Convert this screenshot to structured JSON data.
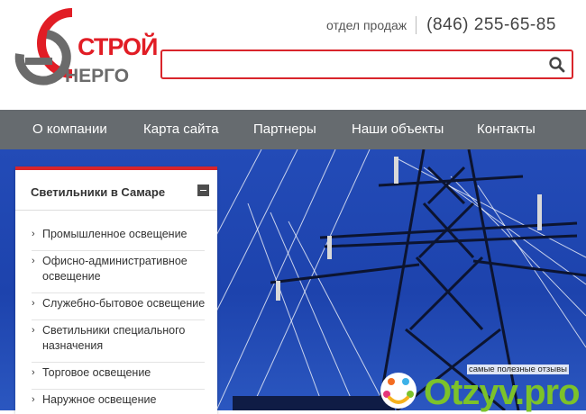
{
  "logo": {
    "line1": "СТРОЙ",
    "line2": "НЕРГО",
    "letter": "Э"
  },
  "header": {
    "department": "отдел продаж",
    "phone": "(846) 255-65-85"
  },
  "search": {
    "value": "",
    "placeholder": ""
  },
  "nav": {
    "items": [
      {
        "label": "О компании"
      },
      {
        "label": "Карта сайта"
      },
      {
        "label": "Партнеры"
      },
      {
        "label": "Наши объекты"
      },
      {
        "label": "Контакты"
      }
    ]
  },
  "sidebar": {
    "title": "Светильники в Самаре",
    "items": [
      {
        "label": "Промышленное освещение"
      },
      {
        "label": "Офисно-административное освещение"
      },
      {
        "label": "Служебно-бытовое освещение"
      },
      {
        "label": "Светильники специального назначения"
      },
      {
        "label": "Торговое освещение"
      },
      {
        "label": "Наружное освещение"
      }
    ]
  },
  "watermark": {
    "tagline": "самые полезные отзывы",
    "brand": "Otzyv.pro"
  },
  "colors": {
    "accent": "#d9252b",
    "nav": "#666b6f",
    "sky": "#234bb7"
  }
}
